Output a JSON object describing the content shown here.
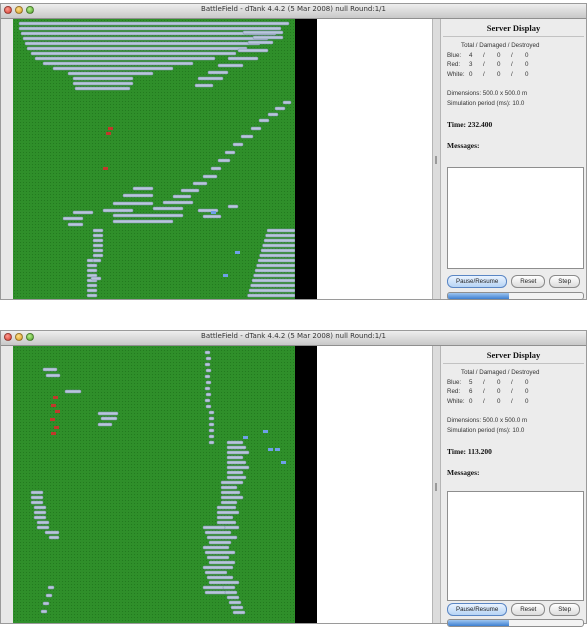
{
  "window_title": "BattleField - dTank 4.4.2 (5 Mar 2008) null Round:1/1",
  "top": {
    "panel_title": "Server Display",
    "stats_header": "Total / Damaged / Destroyed",
    "rows": [
      {
        "label": "Blue:",
        "total": "4",
        "damaged": "0",
        "destroyed": "0"
      },
      {
        "label": "Red:",
        "total": "3",
        "damaged": "0",
        "destroyed": "0"
      },
      {
        "label": "White:",
        "total": "0",
        "damaged": "0",
        "destroyed": "0"
      }
    ],
    "dimensions": "Dimensions: 500.0 x 500.0 m",
    "sim_period": "Simulation period (ms): 10.0",
    "time": "Time: 232.400",
    "messages_label": "Messages:",
    "buttons": {
      "pause": "Pause/Resume",
      "reset": "Reset",
      "step": "Step"
    },
    "progress_fraction": 0.45
  },
  "bottom": {
    "panel_title": "Server Display",
    "stats_header": "Total / Damaged / Destroyed",
    "rows": [
      {
        "label": "Blue:",
        "total": "5",
        "damaged": "0",
        "destroyed": "0"
      },
      {
        "label": "Red:",
        "total": "6",
        "damaged": "0",
        "destroyed": "0"
      },
      {
        "label": "White:",
        "total": "0",
        "damaged": "0",
        "destroyed": "0"
      }
    ],
    "dimensions": "Dimensions: 500.0 x 500.0 m",
    "sim_period": "Simulation period (ms): 10.0",
    "time": "Time: 113.200",
    "messages_label": "Messages:",
    "buttons": {
      "pause": "Pause/Resume",
      "reset": "Reset",
      "step": "Step"
    },
    "progress_fraction": 0.45
  },
  "colors": {
    "terrain": "#2f8f2a",
    "obstacle": "#b8c6dc",
    "red_tank": "#c0392b",
    "blue_tank": "#6fa0e8"
  }
}
